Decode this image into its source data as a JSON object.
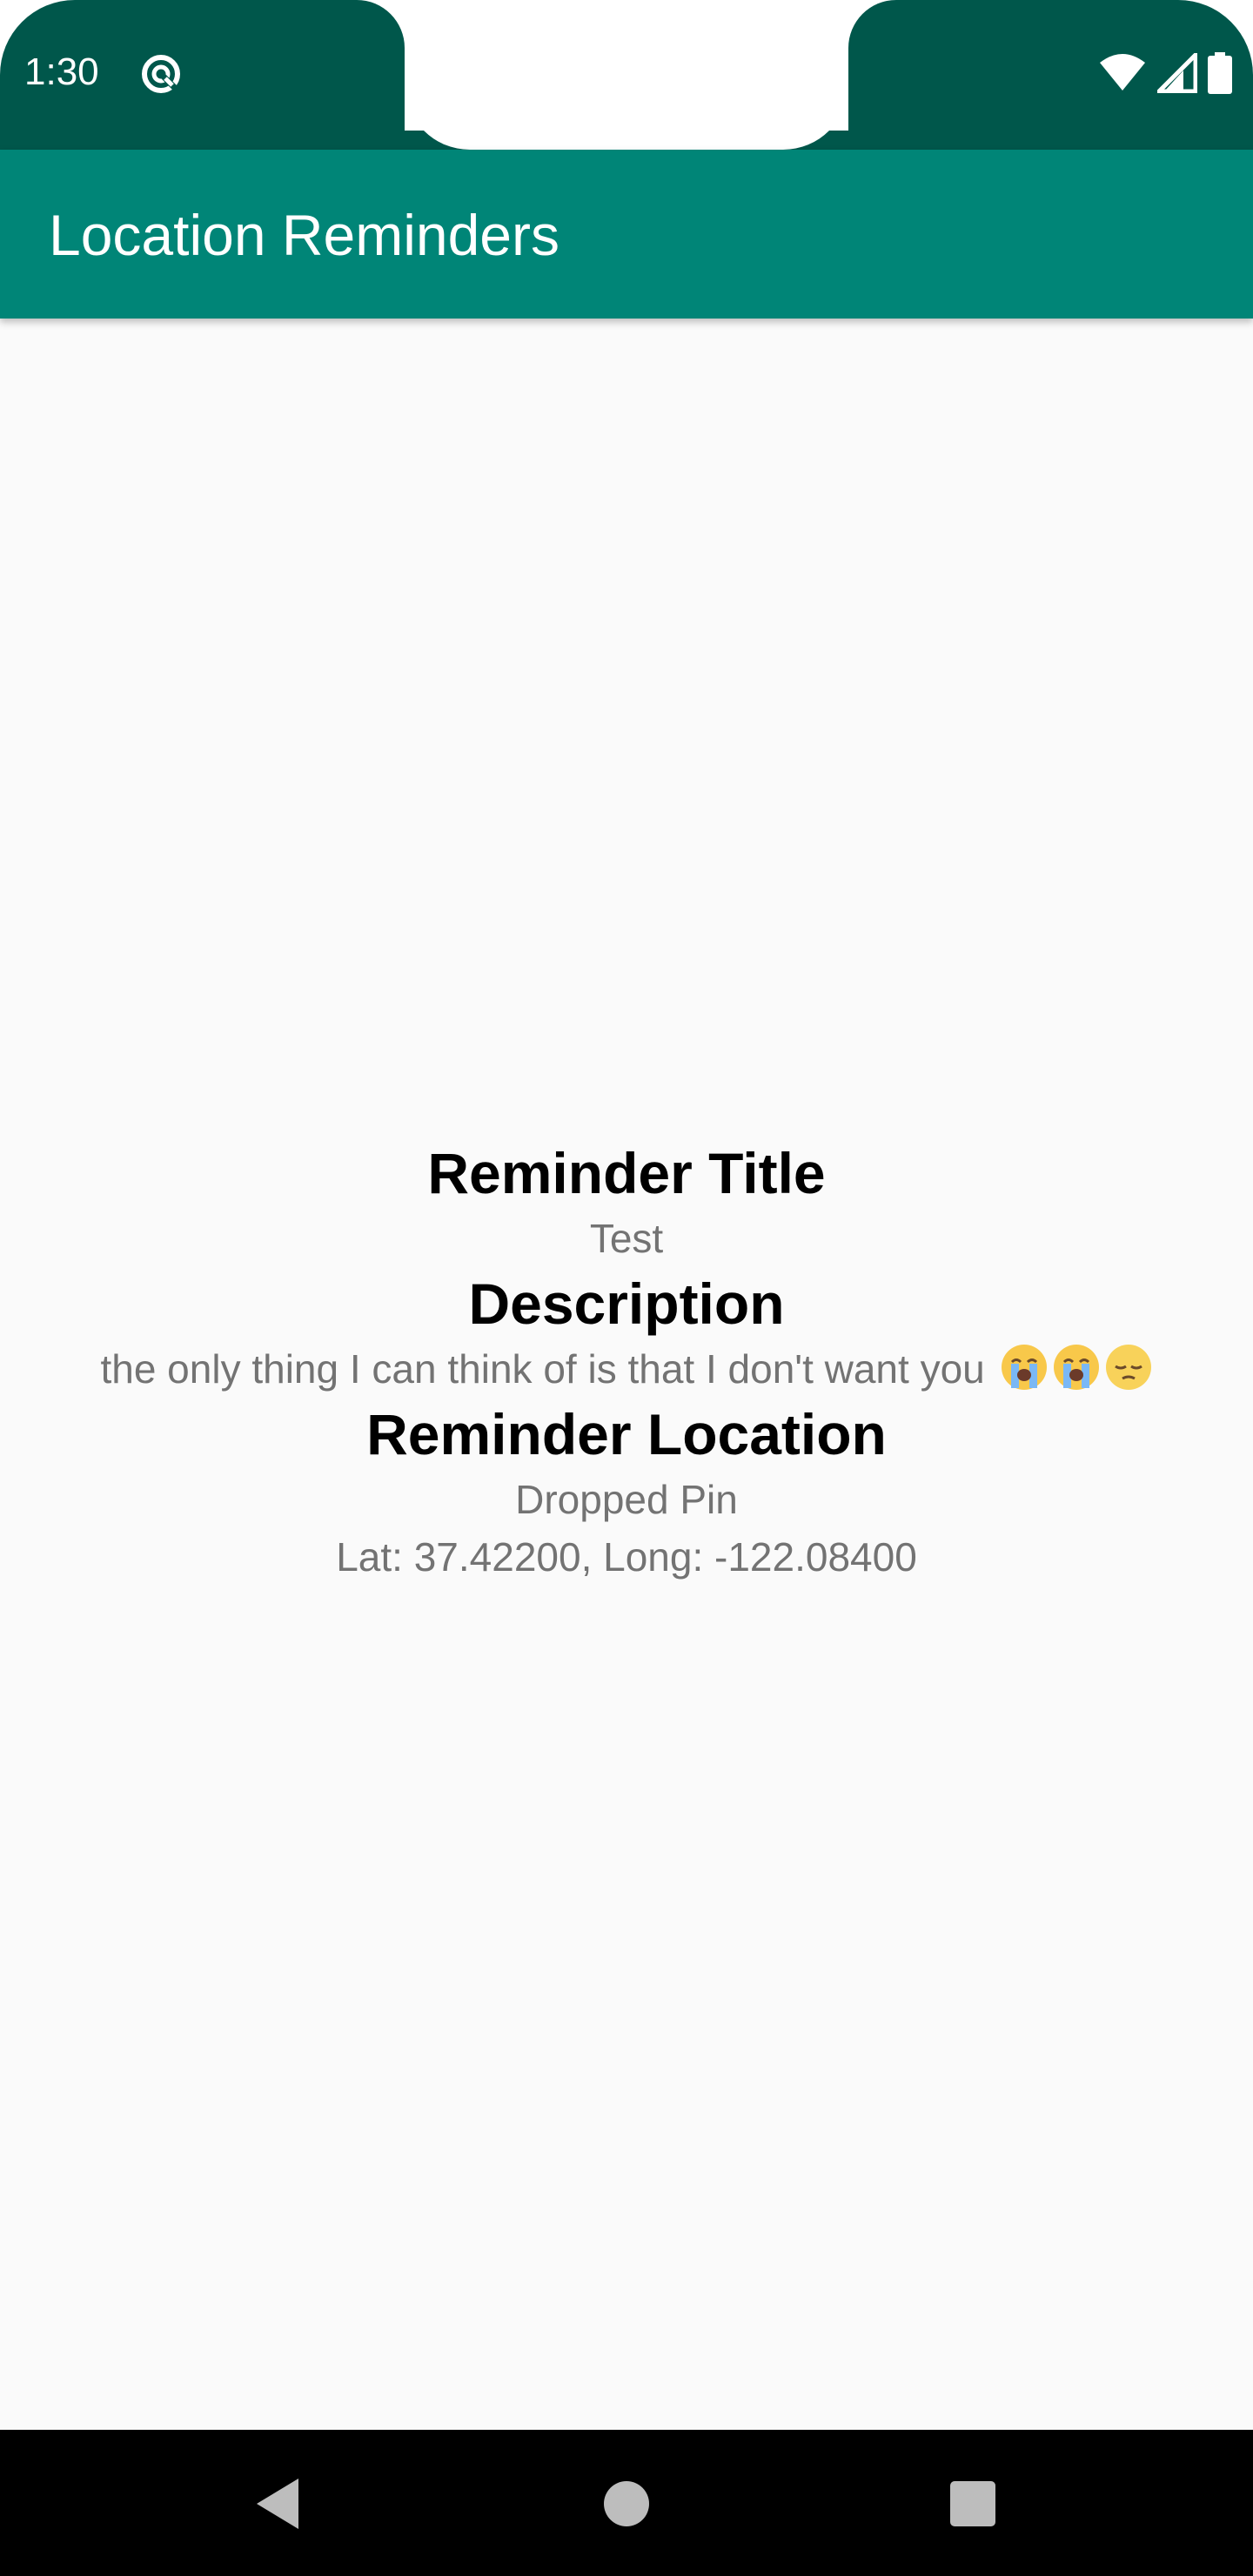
{
  "status_bar": {
    "time": "1:30",
    "icons": [
      "data-saver-icon",
      "wifi-icon",
      "cellular-signal-icon",
      "battery-icon"
    ],
    "color": "#00574b"
  },
  "app_bar": {
    "title": "Location Reminders",
    "color": "#008577"
  },
  "reminder": {
    "title_heading": "Reminder Title",
    "title_value": "Test",
    "description_heading": "Description",
    "description_value": "the only thing I can think of is that I don't want you",
    "description_emojis": [
      "loudly-crying-face-emoji",
      "loudly-crying-face-emoji",
      "pensive-face-emoji"
    ],
    "location_heading": "Reminder Location",
    "location_name": "Dropped Pin",
    "location_coords": "Lat: 37.42200, Long: -122.08400"
  },
  "nav_bar": {
    "buttons": [
      "back-icon",
      "home-icon",
      "recents-icon"
    ]
  }
}
